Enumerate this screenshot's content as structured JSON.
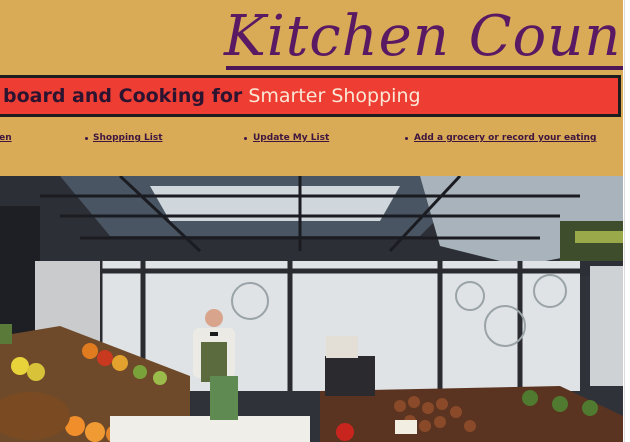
{
  "header": {
    "title": "Kitchen Counter",
    "tagline_dark": "board and Cooking for",
    "tagline_light": "Smarter Shopping"
  },
  "nav": {
    "items": [
      {
        "label": "Kitchen"
      },
      {
        "label": "Shopping List"
      },
      {
        "label": "Update My List"
      },
      {
        "label": "Add a grocery or record your eating"
      }
    ]
  },
  "hero": {
    "description_icon": "market-photo"
  },
  "colors": {
    "background": "#d9ab56",
    "title": "#5a1a63",
    "banner": "#ee3d33",
    "nav_link": "#3f163f"
  }
}
